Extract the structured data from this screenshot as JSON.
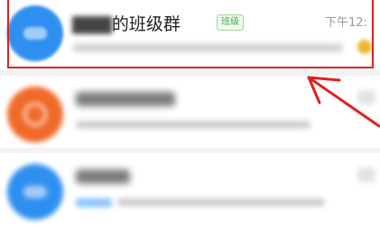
{
  "chat_list": {
    "items": [
      {
        "title_suffix": "的班级群",
        "badge": "班级",
        "time": "下午12:",
        "highlighted": true
      }
    ]
  },
  "colors": {
    "highlight": "#e02020",
    "avatar_blue": "#2f8ff0",
    "avatar_orange": "#f06a2a",
    "badge_green": "#4caf50"
  },
  "icons": [
    "group-avatar-icon",
    "annotation-arrow-icon"
  ]
}
